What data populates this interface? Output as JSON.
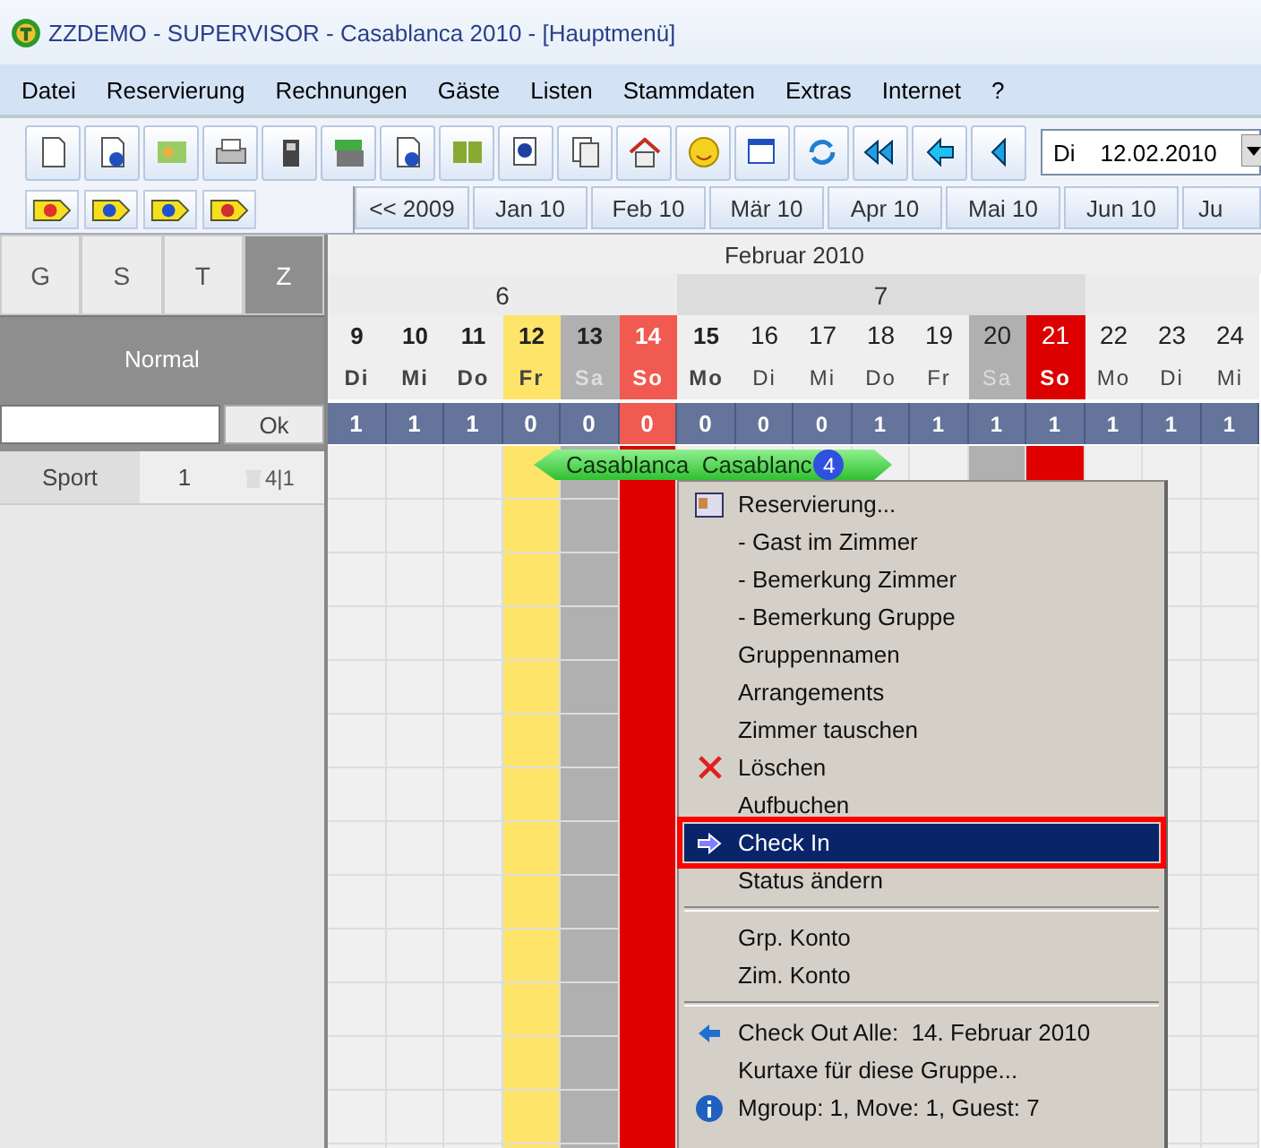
{
  "window": {
    "title": "ZZDEMO - SUPERVISOR - Casablanca 2010 - [Hauptmenü]"
  },
  "menu_bar": [
    "Datei",
    "Reservierung",
    "Rechnungen",
    "Gäste",
    "Listen",
    "Stammdaten",
    "Extras",
    "Internet",
    "?"
  ],
  "date_field": {
    "weekday": "Di",
    "value": "12.02.2010"
  },
  "month_buttons": [
    "<< 2009",
    "Jan 10",
    "Feb 10",
    "Mär 10",
    "Apr 10",
    "Mai 10",
    "Jun 10",
    "Ju"
  ],
  "view_tabs": [
    {
      "label": "G",
      "selected": false
    },
    {
      "label": "S",
      "selected": false
    },
    {
      "label": "T",
      "selected": false
    },
    {
      "label": "Z",
      "selected": true
    }
  ],
  "mode_label": "Normal",
  "filter": {
    "button": "Ok"
  },
  "rooms": [
    {
      "category": "Sport",
      "number": "1",
      "count": "4|1"
    }
  ],
  "calendar": {
    "month": "Februar 2010",
    "weeks": [
      {
        "label": "6",
        "days": [
          {
            "day": "9",
            "weekday": "Di",
            "bold": true,
            "kind": "weekday",
            "count": "1"
          },
          {
            "day": "10",
            "weekday": "Mi",
            "bold": true,
            "kind": "weekday",
            "count": "1"
          },
          {
            "day": "11",
            "weekday": "Do",
            "bold": true,
            "kind": "weekday",
            "count": "1"
          },
          {
            "day": "12",
            "weekday": "Fr",
            "bold": true,
            "kind": "today",
            "count": "0"
          },
          {
            "day": "13",
            "weekday": "Sa",
            "bold": true,
            "kind": "saturday",
            "count": "0"
          },
          {
            "day": "14",
            "weekday": "So",
            "bold": true,
            "kind": "sunday",
            "count": "0"
          }
        ]
      },
      {
        "label": "7",
        "days": [
          {
            "day": "15",
            "weekday": "Mo",
            "bold": true,
            "kind": "weekday",
            "count": "0"
          },
          {
            "day": "16",
            "weekday": "Di",
            "bold": false,
            "kind": "weekday",
            "count": "0"
          },
          {
            "day": "17",
            "weekday": "Mi",
            "bold": false,
            "kind": "weekday",
            "count": "0"
          },
          {
            "day": "18",
            "weekday": "Do",
            "bold": false,
            "kind": "weekday",
            "count": "1"
          },
          {
            "day": "19",
            "weekday": "Fr",
            "bold": false,
            "kind": "weekday",
            "count": "1"
          },
          {
            "day": "20",
            "weekday": "Sa",
            "bold": false,
            "kind": "saturday",
            "count": "1"
          },
          {
            "day": "21",
            "weekday": "So",
            "bold": false,
            "kind": "sunday",
            "count": "1"
          }
        ]
      },
      {
        "days": [
          {
            "day": "22",
            "weekday": "Mo",
            "bold": false,
            "kind": "weekday",
            "count": "1"
          },
          {
            "day": "23",
            "weekday": "Di",
            "bold": false,
            "kind": "weekday",
            "count": "1"
          },
          {
            "day": "24",
            "weekday": "Mi",
            "bold": false,
            "kind": "weekday",
            "count": "1"
          }
        ]
      }
    ],
    "booking": {
      "label": "Casablanca  Casablanc",
      "badge": "4"
    }
  },
  "context_menu": [
    {
      "kind": "reservation",
      "label": "Reservierung...",
      "selected": false
    },
    {
      "kind": "plain",
      "label": "- Gast im Zimmer",
      "selected": false
    },
    {
      "kind": "plain",
      "label": "- Bemerkung Zimmer",
      "selected": false
    },
    {
      "kind": "plain",
      "label": "- Bemerkung Gruppe",
      "selected": false
    },
    {
      "kind": "plain",
      "label": "Gruppennamen",
      "selected": false
    },
    {
      "kind": "plain",
      "label": "Arrangements",
      "selected": false
    },
    {
      "kind": "plain",
      "label": "Zimmer tauschen",
      "selected": false
    },
    {
      "kind": "delete",
      "label": "Löschen",
      "selected": false
    },
    {
      "kind": "plain",
      "label": "Aufbuchen",
      "selected": false
    },
    {
      "kind": "checkin",
      "label": "Check In",
      "selected": true
    },
    {
      "kind": "plain",
      "label": "Status ändern",
      "selected": false
    },
    {
      "kind": "separator"
    },
    {
      "kind": "plain",
      "label": "Grp. Konto",
      "selected": false
    },
    {
      "kind": "plain",
      "label": "Zim. Konto",
      "selected": false
    },
    {
      "kind": "separator"
    },
    {
      "kind": "checkout",
      "label": "Check Out Alle:  14. Februar 2010",
      "selected": false
    },
    {
      "kind": "plain",
      "label": "Kurtaxe für diese Gruppe...",
      "selected": false
    },
    {
      "kind": "info",
      "label": "Mgroup: 1, Move: 1, Guest: 7",
      "selected": false
    }
  ]
}
